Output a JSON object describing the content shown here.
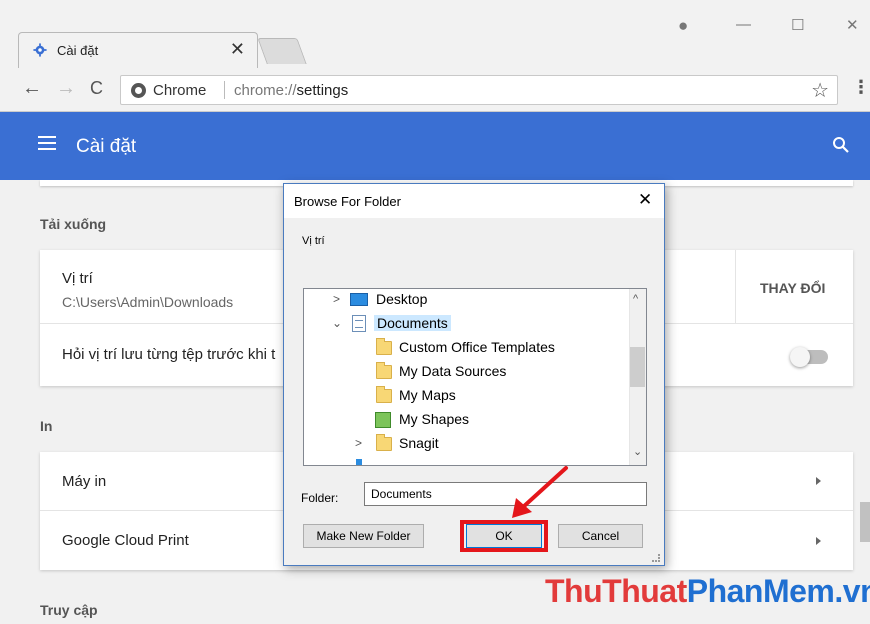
{
  "browser": {
    "tab_title": "Cài đặt",
    "tab_close": "✕",
    "win_controls": {
      "profile": "●",
      "minimize": "—",
      "maximize": "☐",
      "close": "✕"
    },
    "nav": {
      "back": "←",
      "forward": "→",
      "reload": "C"
    },
    "omnibox": {
      "site": "Chrome",
      "url_scheme": "chrome://",
      "url_path": "settings"
    },
    "star": "☆",
    "menu": "⋮"
  },
  "appbar": {
    "title": "Cài đặt"
  },
  "downloads": {
    "section_title": "Tải xuống",
    "location_label": "Vị trí",
    "location_value": "C:\\Users\\Admin\\Downloads",
    "change_button": "THAY ĐỔI",
    "ask_label": "Hỏi vị trí lưu từng tệp trước khi t"
  },
  "printing": {
    "section_title": "In",
    "printers_label": "Máy in",
    "cloud_print_label": "Google Cloud Print"
  },
  "accessibility": {
    "section_title": "Truy cập"
  },
  "dialog": {
    "title": "Browse For Folder",
    "close": "✕",
    "description": "Vị trí",
    "tree": [
      {
        "label": "Desktop"
      },
      {
        "label": "Documents"
      },
      {
        "label": "Custom Office Templates"
      },
      {
        "label": "My Data Sources"
      },
      {
        "label": "My Maps"
      },
      {
        "label": "My Shapes"
      },
      {
        "label": "Snagit"
      }
    ],
    "folder_label": "Folder:",
    "folder_value": "Documents",
    "make_new_folder": "Make New Folder",
    "ok": "OK",
    "cancel": "Cancel"
  },
  "watermark": {
    "part1": "ThuThuat",
    "part2": "PhanMem.vn"
  },
  "colors": {
    "appbar": "#3a6fd3",
    "highlight": "#e4161b"
  }
}
